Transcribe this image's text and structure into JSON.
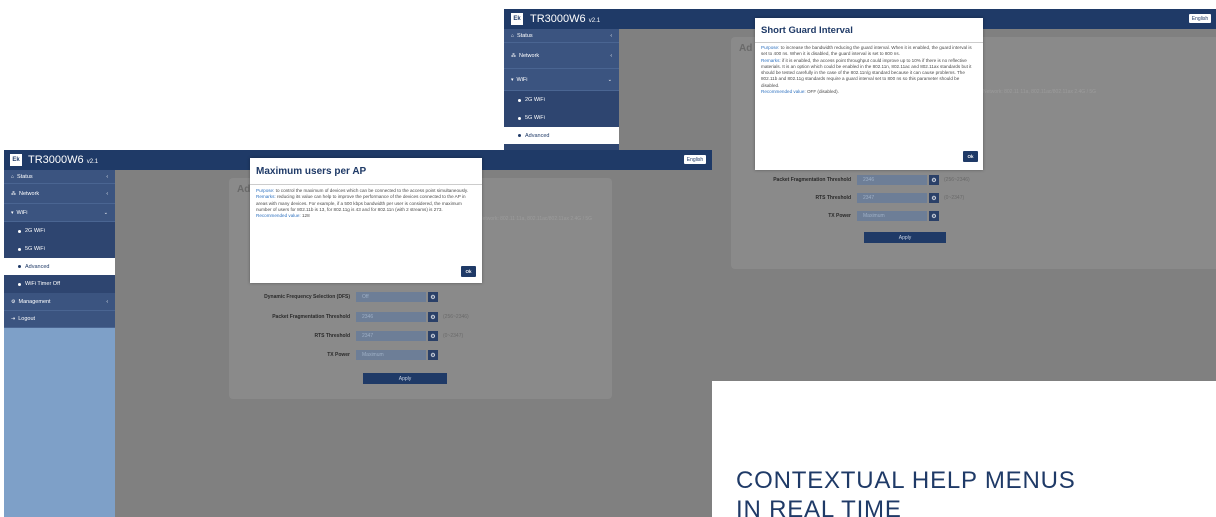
{
  "app": {
    "logo": "Ek",
    "product": "TR3000W6",
    "version": "v2.1",
    "language": "English"
  },
  "menu": {
    "status": "Status",
    "network": "Network",
    "wifi": "WiFi",
    "wifi_2g": "2G WiFi",
    "wifi_5g": "5G WiFi",
    "advanced": "Advanced",
    "timer": "WiFi Timer Off",
    "management": "Management",
    "logout": "Logout"
  },
  "panel": {
    "title_fragment": "Ad",
    "background_text": "Network: 802.11 11a, 802.11ac/802.11ax 2.4G / 5G"
  },
  "form": {
    "dfs_label": "Dynamic Frequency Selection (DFS)",
    "dfs_value": "Off",
    "frag_label": "Packet Fragmentation Threshold",
    "frag_value": "2346",
    "frag_range": "(256~2346)",
    "rts_label": "RTS Threshold",
    "rts_value": "2347",
    "rts_range": "(0~2347)",
    "tx_label": "TX Power",
    "tx_value": "Maximum",
    "apply": "Apply"
  },
  "modal_front": {
    "title": "Maximum users per AP",
    "purpose_label": "Purpose:",
    "purpose_text": "to control the maximum of devices which can be connected to the access point simultaneously.",
    "remarks_label": "Remarks:",
    "remarks_text": "reducing its value can help to improve the performance of the devices connected to the AP in areas with many devices. For example, if a 500 kbps bandwidth per user is considered, the maximum number of users for 802.11b is 13, for 802.11g is 43 and for 802.11n (with 2 streams) is 273.",
    "recommended_label": "Recommended value:",
    "recommended_text": "128",
    "ok": "Ok"
  },
  "modal_back": {
    "title": "Short Guard Interval",
    "purpose_label": "Purpose:",
    "purpose_text": "to increase the bandwidth reducing the guard interval. When it is enabled, the guard interval is set to 400 ns. When it is disabled, the guard interval is set to 800 ns.",
    "remarks_label": "Remarks:",
    "remarks_text": "if it is enabled, the access point throughput could improve up to 10% if there is no reflective materials. It is an option which could be enabled in the 802.11n, 802.11ac and 802.11ax standards but it should be tested carefully in the case of the 802.11n/g standard because it can cause problems. The 802.11b and 802.11g standards require a guard interval set to 800 ns so this parameter should be disabled.",
    "recommended_label": "Recommended value:",
    "recommended_text": "OFF (disabled).",
    "ok": "Ok"
  },
  "headline": {
    "line1": "CONTEXTUAL HELP MENUS",
    "line2": "IN REAL TIME"
  },
  "colors": {
    "navy": "#1f3a67",
    "sidebar": "#7ea0c8",
    "link": "#2f72c0"
  }
}
